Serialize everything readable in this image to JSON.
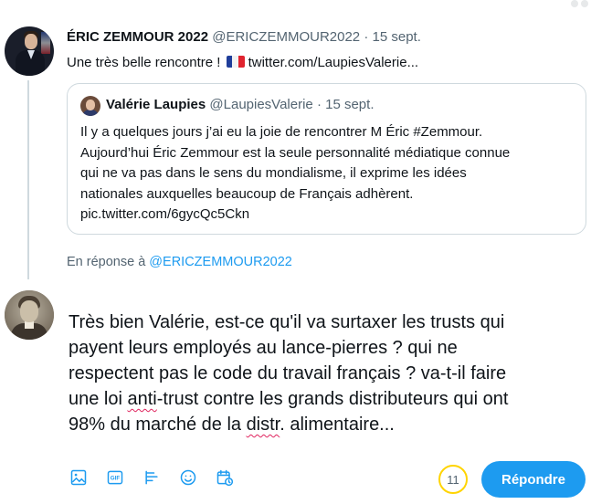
{
  "original_tweet": {
    "author_name": "ÉRIC ZEMMOUR 2022",
    "author_handle": "@ERICZEMMOUR2022",
    "separator": " · ",
    "date": "15 sept.",
    "text_before_flag": "Une très belle rencontre ! ",
    "flag_icon": "flag-france-icon",
    "link_text": "twitter.com/LaupiesValerie..."
  },
  "quoted_tweet": {
    "author_name": "Valérie Laupies",
    "author_handle": "@LaupiesValerie",
    "separator": " · ",
    "date": "15 sept.",
    "lines": [
      "Il y a quelques jours j’ai eu la joie de rencontrer  M Éric #Zemmour.",
      "Aujourd’hui Éric Zemmour est la seule personnalité médiatique connue",
      "qui ne va pas dans le sens du mondialisme, il exprime les idées",
      "nationales auxquelles beaucoup de Français adhèrent.",
      "pic.twitter.com/6gycQc5Ckn"
    ]
  },
  "reply_context": {
    "prefix": "En réponse à ",
    "handle": "@ERICZEMMOUR2022"
  },
  "compose": {
    "line1": "Très bien Valérie, est-ce qu'il va surtaxer les trusts qui",
    "line2": "payent leurs employés au lance-pierres ? qui ne",
    "line3": "respectent pas  le code du travail  français ? va-t-il faire",
    "line4_a": "une loi ",
    "line4_b": "anti",
    "line4_c": "-trust contre les grands distributeurs qui ont",
    "line5_a": "98% du marché de la ",
    "line5_b": "distr",
    "line5_c": ".  alimentaire..."
  },
  "toolbar": {
    "icons": [
      "image-icon",
      "gif-icon",
      "poll-icon",
      "emoji-icon",
      "schedule-icon"
    ],
    "gif_label": "GIF",
    "remaining_chars": "11",
    "reply_button_label": "Répondre"
  },
  "colors": {
    "accent": "#1d9bf0",
    "counter_ring": "#ffd400",
    "text": "#0f1419",
    "muted": "#536471",
    "border": "#cfd9de"
  }
}
